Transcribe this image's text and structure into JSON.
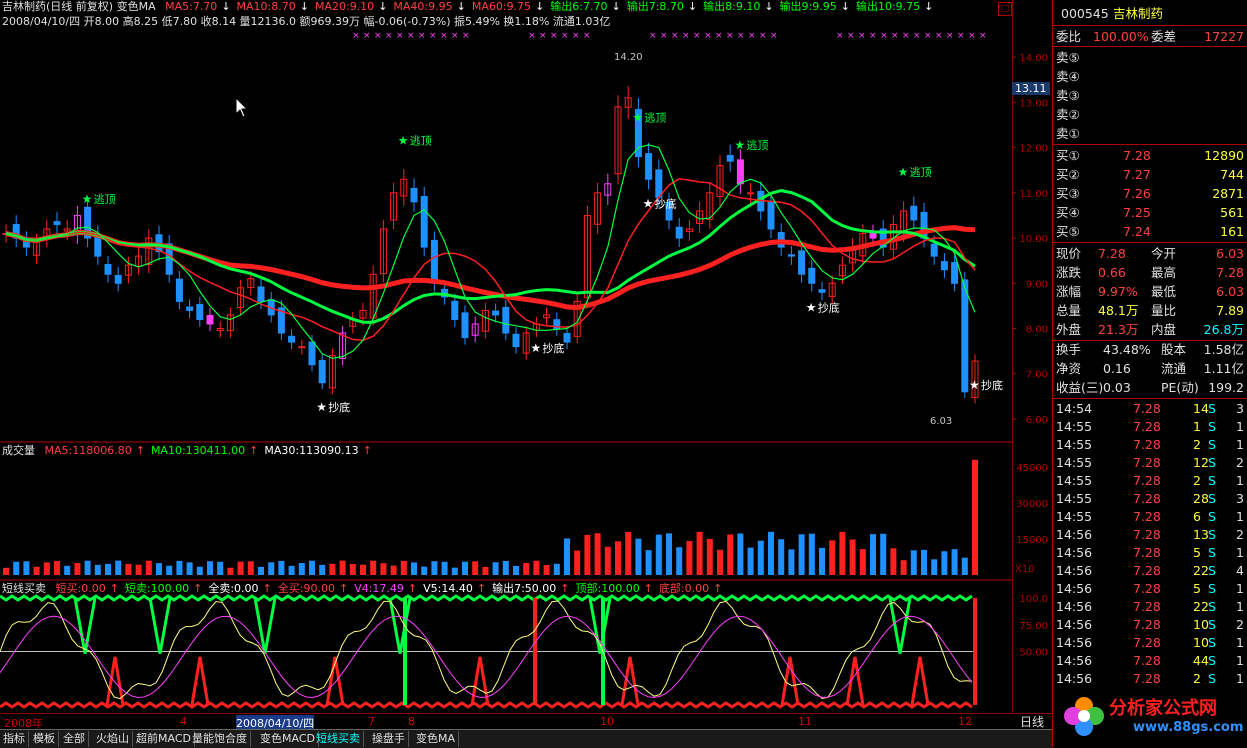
{
  "header": {
    "title": "吉林制药(日线 前复权) 变色MA",
    "ma_items": [
      {
        "label": "MA5:7.70",
        "color": "#ff4040"
      },
      {
        "label": "MA10:8.70",
        "color": "#ff4040"
      },
      {
        "label": "MA20:9.10",
        "color": "#ff4040"
      },
      {
        "label": "MA40:9.95",
        "color": "#ff4040"
      },
      {
        "label": "MA60:9.75",
        "color": "#ff4040"
      },
      {
        "label": "输出6:7.70",
        "color": "#00ff00"
      },
      {
        "label": "输出7:8.70",
        "color": "#00ff00"
      },
      {
        "label": "输出8:9.10",
        "color": "#00ff00"
      },
      {
        "label": "输出9:9.95",
        "color": "#00ff00"
      },
      {
        "label": "输出10:9.75",
        "color": "#00ff00"
      }
    ],
    "line2": "2008/04/10/四 开8.00 高8.25 低7.80 收8.14 量12136.0 额969.39万 幅-0.06(-0.73%) 振5.49% 换1.18% 流通1.03亿"
  },
  "price_axis": [
    "14.00",
    "13.00",
    "12.00",
    "11.00",
    "10.00",
    "9.00",
    "8.00",
    "7.00",
    "6.00"
  ],
  "price_tag": "13.11",
  "low_label": "6.03",
  "high_label": "14.20",
  "signals": {
    "top": "逃顶",
    "bottom": "抄底"
  },
  "volume_panel": {
    "title": "成交量",
    "items": [
      {
        "label": "MA5:118006.80",
        "color": "#ff4040"
      },
      {
        "label": "MA10:130411.00",
        "color": "#00ff00"
      },
      {
        "label": "MA30:113090.13",
        "color": "#ffffff"
      }
    ],
    "axis": [
      "45000",
      "30000",
      "15000"
    ],
    "unit": "X10"
  },
  "indicator_panel": {
    "title": "短线买卖",
    "items": [
      {
        "label": "短买:0.00",
        "color": "#ff4040"
      },
      {
        "label": "短卖:100.00",
        "color": "#00ff00"
      },
      {
        "label": "全卖:0.00",
        "color": "#ffffff"
      },
      {
        "label": "全买:90.00",
        "color": "#ff4040"
      },
      {
        "label": "V4:17.49",
        "color": "#ff40ff"
      },
      {
        "label": "V5:14.40",
        "color": "#ffffff"
      },
      {
        "label": "输出7:50.00",
        "color": "#ffffff"
      },
      {
        "label": "顶部:100.00",
        "color": "#00ff00"
      },
      {
        "label": "底部:0.00",
        "color": "#ff4040"
      }
    ],
    "axis": [
      "100.0",
      "75.00",
      "50.00"
    ]
  },
  "date_axis": {
    "labels": [
      {
        "t": "2008年"
      },
      {
        "t": "4"
      },
      {
        "t": "2008/04/10/四",
        "highlight": true
      },
      {
        "t": "7"
      },
      {
        "t": "8"
      },
      {
        "t": "10"
      },
      {
        "t": "11"
      },
      {
        "t": "12"
      }
    ],
    "period": "日线"
  },
  "tabs": [
    "指标",
    "模板",
    "全部",
    "火焰山",
    "超前MACD",
    "量能饱合度",
    "变色MACD",
    "短线买卖",
    "操盘手",
    "变色MA"
  ],
  "active_tab": "短线买卖",
  "quote": {
    "code": "000545",
    "name": "吉林制药",
    "webi_label": "委比",
    "webi": "100.00%",
    "weicha_label": "委差",
    "weicha": "17227",
    "sell": [
      "卖⑤",
      "卖④",
      "卖③",
      "卖②",
      "卖①"
    ],
    "buy": [
      {
        "l": "买①",
        "p": "7.28",
        "v": "12890"
      },
      {
        "l": "买②",
        "p": "7.27",
        "v": "744"
      },
      {
        "l": "买③",
        "p": "7.26",
        "v": "2871"
      },
      {
        "l": "买④",
        "p": "7.25",
        "v": "561"
      },
      {
        "l": "买⑤",
        "p": "7.24",
        "v": "161"
      }
    ],
    "stats": [
      {
        "l1": "现价",
        "v1": "7.28",
        "l2": "今开",
        "v2": "6.03"
      },
      {
        "l1": "涨跌",
        "v1": "0.66",
        "l2": "最高",
        "v2": "7.28"
      },
      {
        "l1": "涨幅",
        "v1": "9.97%",
        "l2": "最低",
        "v2": "6.03"
      },
      {
        "l1": "总量",
        "v1": "48.1万",
        "l2": "量比",
        "v2": "7.89"
      },
      {
        "l1": "外盘",
        "v1": "21.3万",
        "l2": "内盘",
        "v2": "26.8万"
      }
    ],
    "stats2": [
      {
        "l1": "换手",
        "v1": "43.48%",
        "l2": "股本",
        "v2": "1.58亿"
      },
      {
        "l1": "净资",
        "v1": "0.16",
        "l2": "流通",
        "v2": "1.11亿"
      },
      {
        "l1": "收益(三)",
        "v1": "0.03",
        "l2": "PE(动)",
        "v2": "199.2"
      }
    ],
    "ticks": [
      {
        "t": "14:54",
        "p": "7.28",
        "v": "14",
        "s": "S",
        "n": "3"
      },
      {
        "t": "14:55",
        "p": "7.28",
        "v": "1",
        "s": "S",
        "n": "1"
      },
      {
        "t": "14:55",
        "p": "7.28",
        "v": "2",
        "s": "S",
        "n": "1"
      },
      {
        "t": "14:55",
        "p": "7.28",
        "v": "12",
        "s": "S",
        "n": "2"
      },
      {
        "t": "14:55",
        "p": "7.28",
        "v": "2",
        "s": "S",
        "n": "1"
      },
      {
        "t": "14:55",
        "p": "7.28",
        "v": "28",
        "s": "S",
        "n": "3"
      },
      {
        "t": "14:55",
        "p": "7.28",
        "v": "6",
        "s": "S",
        "n": "1"
      },
      {
        "t": "14:56",
        "p": "7.28",
        "v": "13",
        "s": "S",
        "n": "2"
      },
      {
        "t": "14:56",
        "p": "7.28",
        "v": "5",
        "s": "S",
        "n": "1"
      },
      {
        "t": "14:56",
        "p": "7.28",
        "v": "22",
        "s": "S",
        "n": "4"
      },
      {
        "t": "14:56",
        "p": "7.28",
        "v": "5",
        "s": "S",
        "n": "1"
      },
      {
        "t": "14:56",
        "p": "7.28",
        "v": "22",
        "s": "S",
        "n": "1"
      },
      {
        "t": "14:56",
        "p": "7.28",
        "v": "10",
        "s": "S",
        "n": "2"
      },
      {
        "t": "14:56",
        "p": "7.28",
        "v": "10",
        "s": "S",
        "n": "1"
      },
      {
        "t": "14:56",
        "p": "7.28",
        "v": "44",
        "s": "S",
        "n": "1"
      },
      {
        "t": "14:56",
        "p": "7.28",
        "v": "2",
        "s": "S",
        "n": "1"
      }
    ],
    "logo": "分析家公式网",
    "logo_url": "www.88gs.com"
  },
  "colors": {
    "up": "#ff2020",
    "down": "#1e90ff",
    "ma_green": "#00ff40",
    "panel_red": "#b00000"
  },
  "chart_data": {
    "type": "candlestick",
    "price_range": [
      5.8,
      14.6
    ],
    "closes": [
      10.1,
      10.0,
      9.8,
      9.9,
      10.2,
      10.3,
      10.2,
      10.5,
      10.0,
      9.6,
      9.2,
      9.0,
      9.4,
      9.6,
      10.0,
      9.7,
      9.2,
      8.6,
      8.4,
      8.2,
      8.1,
      8.0,
      8.3,
      8.9,
      9.1,
      8.6,
      8.3,
      7.9,
      7.7,
      7.6,
      7.2,
      6.8,
      7.4,
      7.9,
      8.2,
      8.4,
      9.2,
      10.2,
      11.0,
      11.3,
      10.8,
      9.8,
      9.0,
      8.7,
      8.2,
      7.8,
      8.1,
      8.4,
      8.3,
      7.9,
      7.6,
      7.9,
      8.1,
      8.3,
      8.0,
      7.7,
      8.6,
      10.5,
      11.0,
      11.2,
      12.9,
      13.1,
      11.8,
      11.3,
      10.9,
      10.4,
      10.0,
      10.2,
      10.6,
      11.0,
      11.6,
      11.7,
      11.2,
      11.0,
      10.6,
      10.2,
      9.8,
      9.6,
      9.2,
      9.0,
      8.8,
      9.0,
      9.4,
      9.8,
      10.1,
      10.0,
      9.8,
      10.3,
      10.6,
      10.4,
      10.0,
      9.6,
      9.3,
      9.0,
      6.6,
      7.28
    ]
  }
}
